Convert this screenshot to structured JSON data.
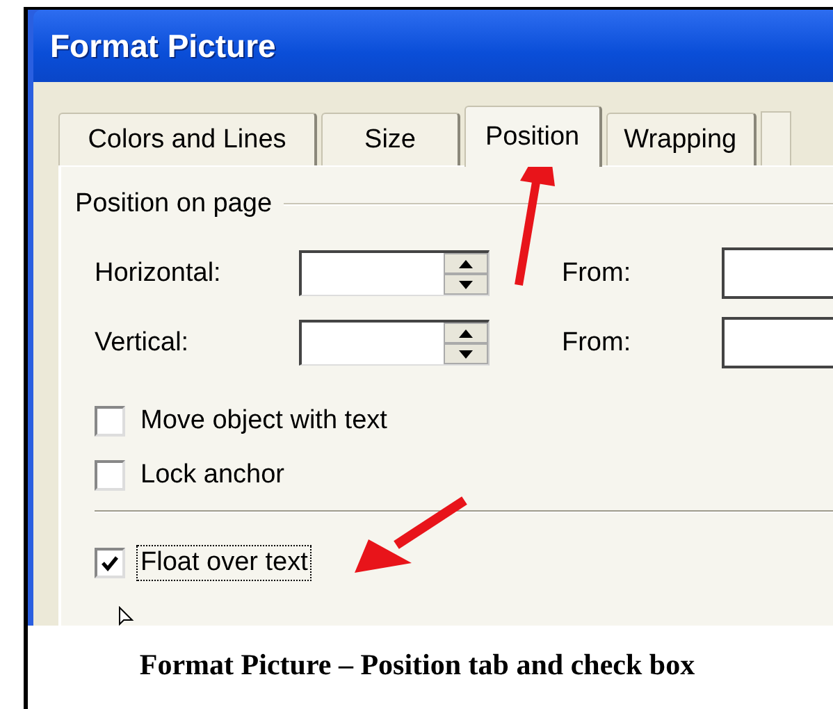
{
  "window": {
    "title": "Format Picture"
  },
  "tabs": [
    {
      "label": "Colors and Lines",
      "selected": false
    },
    {
      "label": "Size",
      "selected": false
    },
    {
      "label": "Position",
      "selected": true
    },
    {
      "label": "Wrapping",
      "selected": false
    }
  ],
  "group": {
    "title": "Position on page"
  },
  "position_rows": [
    {
      "label": "Horizontal:",
      "from_label": "From:"
    },
    {
      "label": "Vertical:",
      "from_label": "From:"
    }
  ],
  "checkbox_groups": [
    [
      {
        "label": "Move object with text",
        "checked": false,
        "focused": false
      },
      {
        "label": "Lock anchor",
        "checked": false,
        "focused": false
      }
    ],
    [
      {
        "label": "Float over text",
        "checked": true,
        "focused": true
      }
    ]
  ],
  "caption": "Format Picture – Position tab and check box"
}
